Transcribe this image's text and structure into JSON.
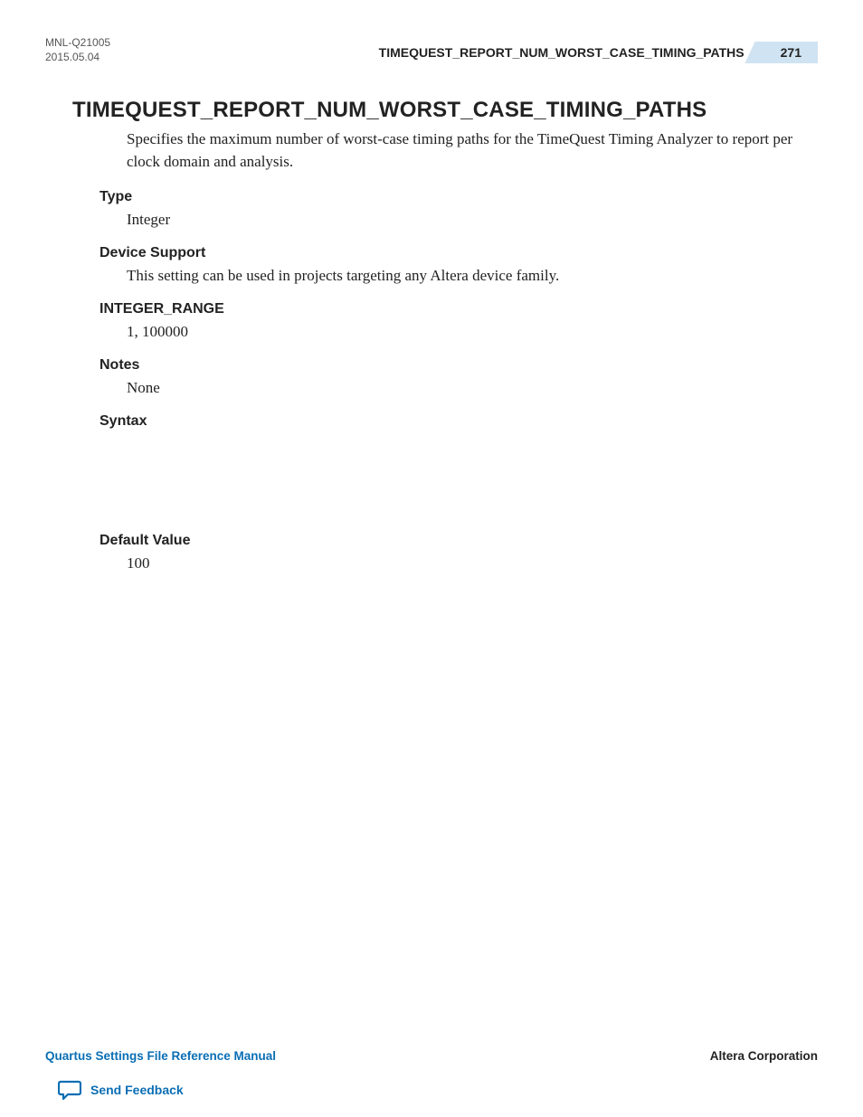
{
  "header": {
    "doc_id": "MNL-Q21005",
    "date": "2015.05.04",
    "running_head": "TIMEQUEST_REPORT_NUM_WORST_CASE_TIMING_PATHS",
    "page_number": "271"
  },
  "title": "TIMEQUEST_REPORT_NUM_WORST_CASE_TIMING_PATHS",
  "description": "Specifies the maximum number of worst-case timing paths for the TimeQuest Timing Analyzer to report per clock domain and analysis.",
  "sections": {
    "type": {
      "heading": "Type",
      "body": "Integer"
    },
    "device_support": {
      "heading": "Device Support",
      "body": "This setting can be used in projects targeting any Altera device family."
    },
    "integer_range": {
      "heading": "INTEGER_RANGE",
      "body": "1, 100000"
    },
    "notes": {
      "heading": "Notes",
      "body": "None"
    },
    "syntax": {
      "heading": "Syntax",
      "body": ""
    },
    "default_value": {
      "heading": "Default Value",
      "body": "100"
    }
  },
  "footer": {
    "manual": "Quartus Settings File Reference Manual",
    "corp": "Altera Corporation",
    "feedback": "Send Feedback"
  }
}
